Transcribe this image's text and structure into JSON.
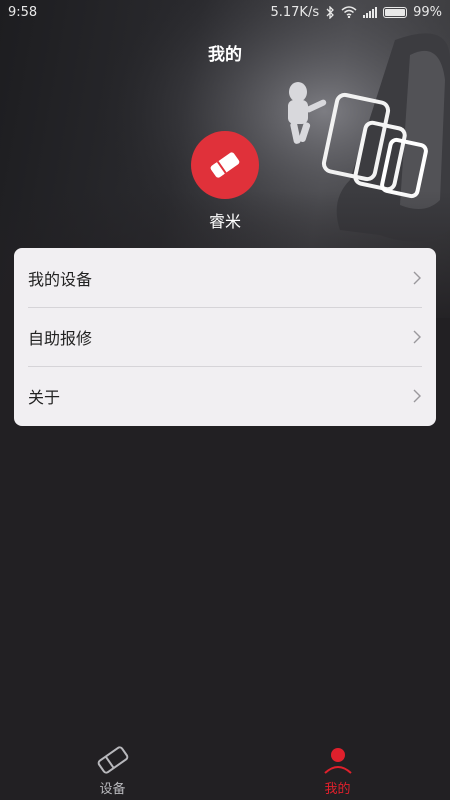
{
  "status_bar": {
    "time": "9:58",
    "network_speed": "5.17K/s",
    "battery": "99%",
    "battery_level": 0.99
  },
  "header": {
    "title": "我的"
  },
  "profile": {
    "avatar_icon": "eraser-icon",
    "name": "睿米"
  },
  "menu": {
    "items": [
      {
        "label": "我的设备",
        "icon": "chevron-right-icon"
      },
      {
        "label": "自助报修",
        "icon": "chevron-right-icon"
      },
      {
        "label": "关于",
        "icon": "chevron-right-icon"
      }
    ]
  },
  "bottom_nav": {
    "tabs": [
      {
        "label": "设备",
        "icon": "eraser-outline-icon",
        "active": false
      },
      {
        "label": "我的",
        "icon": "person-icon",
        "active": true
      }
    ]
  },
  "colors": {
    "accent": "#e0202c",
    "avatar_bg": "#e0313a",
    "background": "#222023",
    "card": "#f1eff2"
  }
}
